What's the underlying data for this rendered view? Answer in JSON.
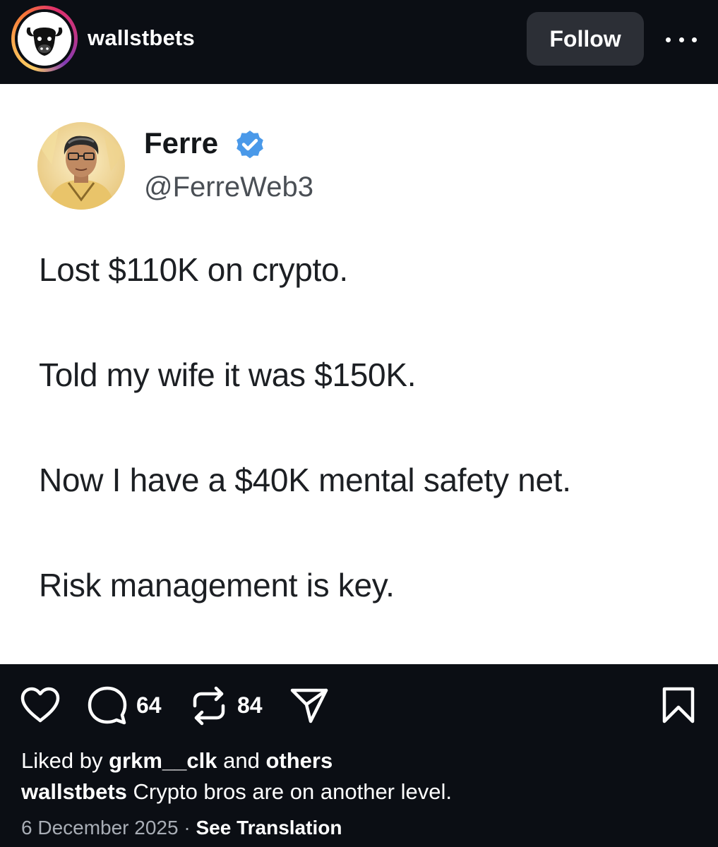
{
  "header": {
    "username": "wallstbets",
    "follow_label": "Follow",
    "avatar_icon": "bull-logo-icon",
    "more_icon": "more-options-icon"
  },
  "tweet": {
    "display_name": "Ferre",
    "handle": "@FerreWeb3",
    "verified": true,
    "verified_color": "#4a99e9",
    "lines": [
      "Lost $110K on crypto.",
      "Told my wife it was $150K.",
      "Now I have a $40K mental safety net.",
      "Risk management is key."
    ]
  },
  "actions": {
    "like_icon": "heart-icon",
    "comment_icon": "comment-icon",
    "comment_count": "64",
    "repost_icon": "repost-icon",
    "repost_count": "84",
    "share_icon": "share-icon",
    "save_icon": "bookmark-icon"
  },
  "meta": {
    "liked_prefix": "Liked by",
    "liked_user": "grkm__clk",
    "liked_conj": "and",
    "liked_others": "others",
    "caption_user": "wallstbets",
    "caption_text": "Crypto bros are on another level.",
    "date": "6 December 2025",
    "separator": "·",
    "translation_label": "See Translation"
  }
}
